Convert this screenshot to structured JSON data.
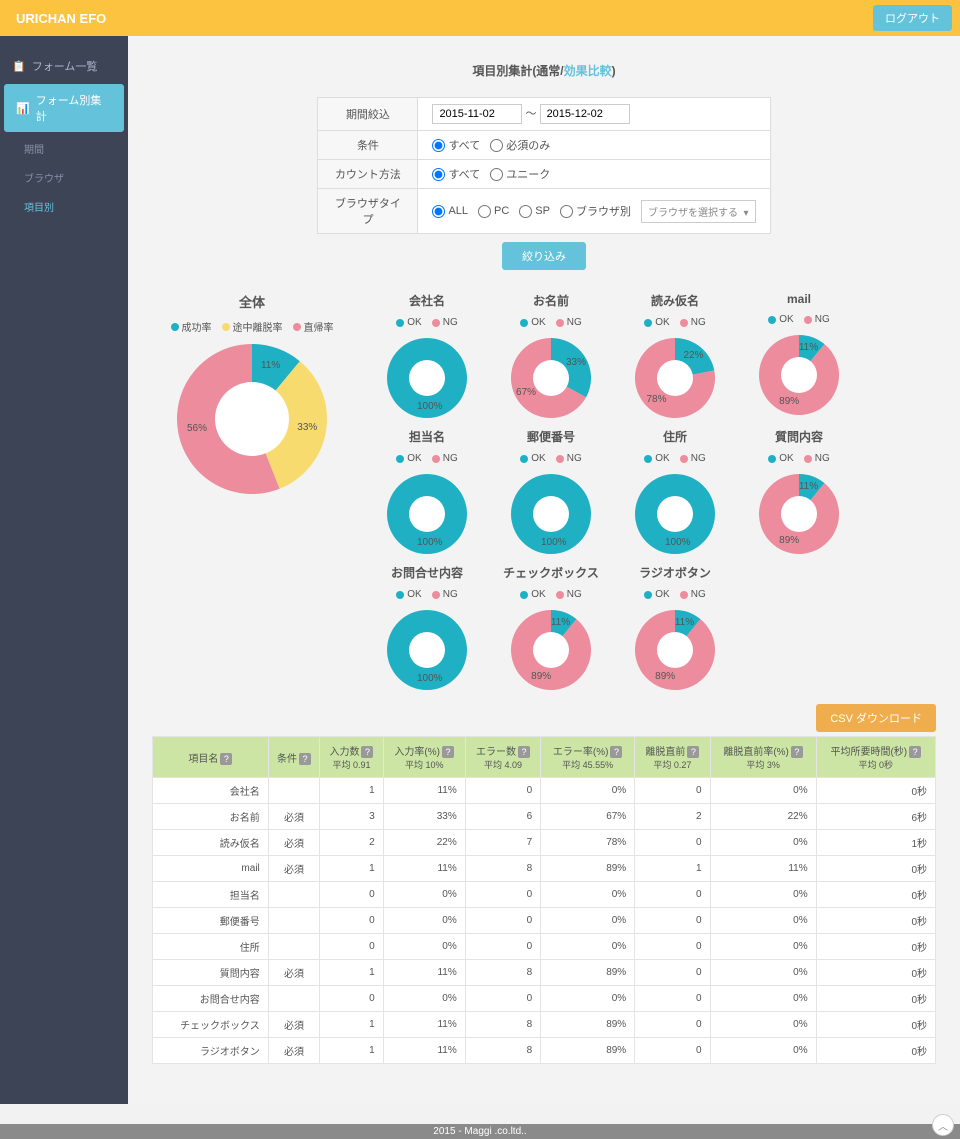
{
  "brand": "URICHAN EFO",
  "logout": "ログアウト",
  "sidebar": {
    "forms_list": "フォーム一覧",
    "form_stats": "フォーム別集計",
    "sub_period": "期間",
    "sub_browser": "ブラウザ",
    "sub_item": "項目別"
  },
  "page": {
    "title_prefix": "項目別集計(通常/",
    "title_link": "効果比較",
    "title_suffix": ")"
  },
  "filter": {
    "period_label": "期間絞込",
    "date_from": "2015-11-02",
    "date_sep": "～",
    "date_to": "2015-12-02",
    "cond_label": "条件",
    "cond_all": "すべて",
    "cond_req": "必須のみ",
    "count_label": "カウント方法",
    "count_all": "すべて",
    "count_unique": "ユニーク",
    "browser_label": "ブラウザタイプ",
    "b_all": "ALL",
    "b_pc": "PC",
    "b_sp": "SP",
    "b_sep": "ブラウザ別",
    "b_select": "ブラウザを選択する",
    "submit": "絞り込み"
  },
  "chart_data": {
    "overall": {
      "title": "全体",
      "type": "pie",
      "series": [
        {
          "name": "成功率",
          "value": 11,
          "color": "#1FB0C4"
        },
        {
          "name": "途中離脱率",
          "value": 33,
          "color": "#F7DB6F"
        },
        {
          "name": "直帰率",
          "value": 56,
          "color": "#EC8C9D"
        }
      ]
    },
    "items": [
      {
        "title": "会社名",
        "ok": 100,
        "ng": 0
      },
      {
        "title": "お名前",
        "ok": 33,
        "ng": 67
      },
      {
        "title": "読み仮名",
        "ok": 22,
        "ng": 78
      },
      {
        "title": "mail",
        "ok": 11,
        "ng": 89
      },
      {
        "title": "担当名",
        "ok": 100,
        "ng": 0
      },
      {
        "title": "郵便番号",
        "ok": 100,
        "ng": 0
      },
      {
        "title": "住所",
        "ok": 100,
        "ng": 0
      },
      {
        "title": "質問内容",
        "ok": 11,
        "ng": 89
      },
      {
        "title": "お問合せ内容",
        "ok": 100,
        "ng": 0
      },
      {
        "title": "チェックボックス",
        "ok": 11,
        "ng": 89
      },
      {
        "title": "ラジオボタン",
        "ok": 11,
        "ng": 89
      }
    ],
    "ok_label": "OK",
    "ng_label": "NG"
  },
  "csv_label": "CSV ダウンロード",
  "table": {
    "headers": {
      "name": "項目名",
      "cond": "条件",
      "input_n": "入力数",
      "input_n_avg": "平均 0.91",
      "input_r": "入力率(%)",
      "input_r_avg": "平均 10%",
      "err_n": "エラー数",
      "err_n_avg": "平均 4.09",
      "err_r": "エラー率(%)",
      "err_r_avg": "平均 45.55%",
      "leave_n": "離脱直前",
      "leave_n_avg": "平均 0.27",
      "leave_r": "離脱直前率(%)",
      "leave_r_avg": "平均 3%",
      "time": "平均所要時間(秒)",
      "time_avg": "平均 0秒"
    },
    "rows": [
      {
        "name": "会社名",
        "cond": "",
        "in_n": 1,
        "in_r": "11%",
        "er_n": 0,
        "er_r": "0%",
        "lv_n": 0,
        "lv_r": "0%",
        "tm": "0秒"
      },
      {
        "name": "お名前",
        "cond": "必須",
        "in_n": 3,
        "in_r": "33%",
        "er_n": 6,
        "er_r": "67%",
        "lv_n": 2,
        "lv_r": "22%",
        "tm": "6秒"
      },
      {
        "name": "読み仮名",
        "cond": "必須",
        "in_n": 2,
        "in_r": "22%",
        "er_n": 7,
        "er_r": "78%",
        "lv_n": 0,
        "lv_r": "0%",
        "tm": "1秒"
      },
      {
        "name": "mail",
        "cond": "必須",
        "in_n": 1,
        "in_r": "11%",
        "er_n": 8,
        "er_r": "89%",
        "lv_n": 1,
        "lv_r": "11%",
        "tm": "0秒"
      },
      {
        "name": "担当名",
        "cond": "",
        "in_n": 0,
        "in_r": "0%",
        "er_n": 0,
        "er_r": "0%",
        "lv_n": 0,
        "lv_r": "0%",
        "tm": "0秒"
      },
      {
        "name": "郵便番号",
        "cond": "",
        "in_n": 0,
        "in_r": "0%",
        "er_n": 0,
        "er_r": "0%",
        "lv_n": 0,
        "lv_r": "0%",
        "tm": "0秒"
      },
      {
        "name": "住所",
        "cond": "",
        "in_n": 0,
        "in_r": "0%",
        "er_n": 0,
        "er_r": "0%",
        "lv_n": 0,
        "lv_r": "0%",
        "tm": "0秒"
      },
      {
        "name": "質問内容",
        "cond": "必須",
        "in_n": 1,
        "in_r": "11%",
        "er_n": 8,
        "er_r": "89%",
        "lv_n": 0,
        "lv_r": "0%",
        "tm": "0秒"
      },
      {
        "name": "お問合せ内容",
        "cond": "",
        "in_n": 0,
        "in_r": "0%",
        "er_n": 0,
        "er_r": "0%",
        "lv_n": 0,
        "lv_r": "0%",
        "tm": "0秒"
      },
      {
        "name": "チェックボックス",
        "cond": "必須",
        "in_n": 1,
        "in_r": "11%",
        "er_n": 8,
        "er_r": "89%",
        "lv_n": 0,
        "lv_r": "0%",
        "tm": "0秒"
      },
      {
        "name": "ラジオボタン",
        "cond": "必須",
        "in_n": 1,
        "in_r": "11%",
        "er_n": 8,
        "er_r": "89%",
        "lv_n": 0,
        "lv_r": "0%",
        "tm": "0秒"
      }
    ]
  },
  "footer": "2015 - Maggi .co.ltd.."
}
